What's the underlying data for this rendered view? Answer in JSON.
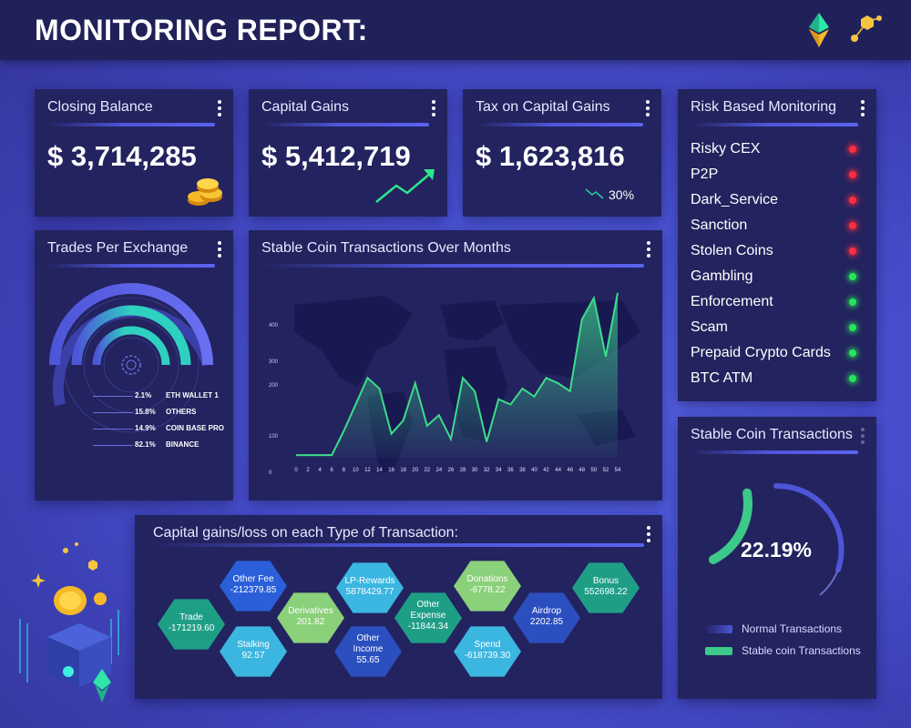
{
  "header": {
    "title": "MONITORING REPORT:"
  },
  "cards": {
    "closing_balance": {
      "title": "Closing Balance",
      "value": "$ 3,714,285"
    },
    "capital_gains": {
      "title": "Capital Gains",
      "value": "$ 5,412,719"
    },
    "tax": {
      "title": "Tax on Capital Gains",
      "value": "$ 1,623,816",
      "change": "30%"
    }
  },
  "risk": {
    "title": "Risk Based Monitoring",
    "items": [
      {
        "label": "Risky CEX",
        "status": "red"
      },
      {
        "label": "P2P",
        "status": "red"
      },
      {
        "label": "Dark_Service",
        "status": "red"
      },
      {
        "label": "Sanction",
        "status": "red"
      },
      {
        "label": "Stolen Coins",
        "status": "red"
      },
      {
        "label": "Gambling",
        "status": "green"
      },
      {
        "label": "Enforcement",
        "status": "green"
      },
      {
        "label": "Scam",
        "status": "green"
      },
      {
        "label": "Prepaid Crypto Cards",
        "status": "green"
      },
      {
        "label": "BTC ATM",
        "status": "green"
      }
    ]
  },
  "trades": {
    "title": "Trades Per Exchange",
    "items": [
      {
        "pct": "2.1%",
        "label": "ETH WALLET 1"
      },
      {
        "pct": "15.8%",
        "label": "OTHERS"
      },
      {
        "pct": "14.9%",
        "label": "COIN BASE PRO"
      },
      {
        "pct": "82.1%",
        "label": "BINANCE"
      }
    ]
  },
  "stable_months": {
    "title": "Stable Coin Transactions Over Months",
    "chart_data": {
      "type": "area",
      "x": [
        0,
        2,
        4,
        6,
        8,
        10,
        12,
        14,
        16,
        18,
        20,
        22,
        24,
        26,
        28,
        30,
        32,
        34,
        36,
        38,
        40,
        42,
        44,
        46,
        48,
        50,
        52,
        54
      ],
      "y_ticks": [
        "0",
        "100",
        "200",
        "300",
        "400"
      ],
      "series": [
        {
          "values": [
            10,
            10,
            10,
            10,
            100,
            200,
            300,
            260,
            90,
            140,
            280,
            120,
            160,
            70,
            300,
            250,
            60,
            220,
            200,
            260,
            230,
            300,
            280,
            250,
            520,
            600,
            380,
            620
          ]
        }
      ],
      "ylim": [
        0,
        650
      ]
    }
  },
  "capital_tx": {
    "title": "Capital gains/loss on each Type of Transaction:",
    "items": [
      {
        "label": "Trade",
        "value": "-171219.60",
        "color": "#1f9e86"
      },
      {
        "label": "Other Fee",
        "value": "-212379.85",
        "color": "#2b5fd9"
      },
      {
        "label": "Stalking",
        "value": "92.57",
        "color": "#3bb6e0"
      },
      {
        "label": "Derivatives",
        "value": "201.82",
        "color": "#8bd07a"
      },
      {
        "label": "LP-Rewards",
        "value": "5878429.77",
        "color": "#3bb6e0"
      },
      {
        "label": "Other Income",
        "value": "55.65",
        "color": "#2b4fbf"
      },
      {
        "label": "Other Expense",
        "value": "-11844.34",
        "color": "#1f9e86"
      },
      {
        "label": "Donations",
        "value": "-6778.22",
        "color": "#8bd07a"
      },
      {
        "label": "Spend",
        "value": "-618739.30",
        "color": "#3bb6e0"
      },
      {
        "label": "Airdrop",
        "value": "2202.85",
        "color": "#2b4fbf"
      },
      {
        "label": "Bonus",
        "value": "552698.22",
        "color": "#1f9e86"
      }
    ]
  },
  "stable_tx": {
    "title": "Stable Coin Transactions",
    "percent": "22.19%",
    "fraction": 0.2219,
    "legend": [
      {
        "label": "Normal Transactions",
        "color": "#4d55d8"
      },
      {
        "label": "Stable coin Transactions",
        "color": "#3cc98a"
      }
    ]
  }
}
